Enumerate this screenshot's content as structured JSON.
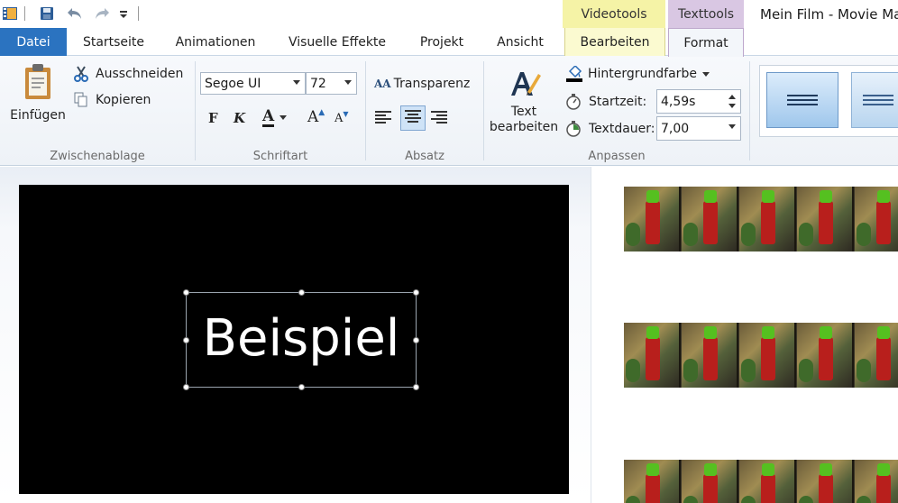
{
  "window": {
    "title": "Mein Film - Movie Ma"
  },
  "quick_access": {
    "icons": [
      "film-icon",
      "save-icon",
      "undo-icon",
      "redo-icon",
      "customize-icon"
    ]
  },
  "context_tabs": {
    "video_tools": "Videotools",
    "text_tools": "Texttools"
  },
  "tabs": {
    "datei": "Datei",
    "startseite": "Startseite",
    "animationen": "Animationen",
    "visuelle_effekte": "Visuelle Effekte",
    "projekt": "Projekt",
    "ansicht": "Ansicht",
    "bearbeiten": "Bearbeiten",
    "format": "Format"
  },
  "ribbon": {
    "zwischenablage": {
      "label": "Zwischenablage",
      "paste": "Einfügen",
      "cut": "Ausschneiden",
      "copy": "Kopieren"
    },
    "schriftart": {
      "label": "Schriftart",
      "font": "Segoe UI",
      "size": "72",
      "bold": "F",
      "italic": "K",
      "color": "A",
      "grow": "A",
      "shrink": "A"
    },
    "absatz": {
      "label": "Absatz",
      "transparency_prefix": "AA",
      "transparency": "Transparenz"
    },
    "anpassen": {
      "label": "Anpassen",
      "edit_text_line1": "Text",
      "edit_text_line2": "bearbeiten",
      "background": "Hintergrundfarbe",
      "start_label": "Startzeit:",
      "start_value": "4,59s",
      "duration_label": "Textdauer:",
      "duration_value": "7,00"
    }
  },
  "preview": {
    "overlay_text": "Beispiel"
  },
  "colors": {
    "datei_tab": "#2b73c0",
    "video_tools": "#f5f3a6",
    "text_tools": "#d9c7e3",
    "accent": "#2b73c0"
  }
}
